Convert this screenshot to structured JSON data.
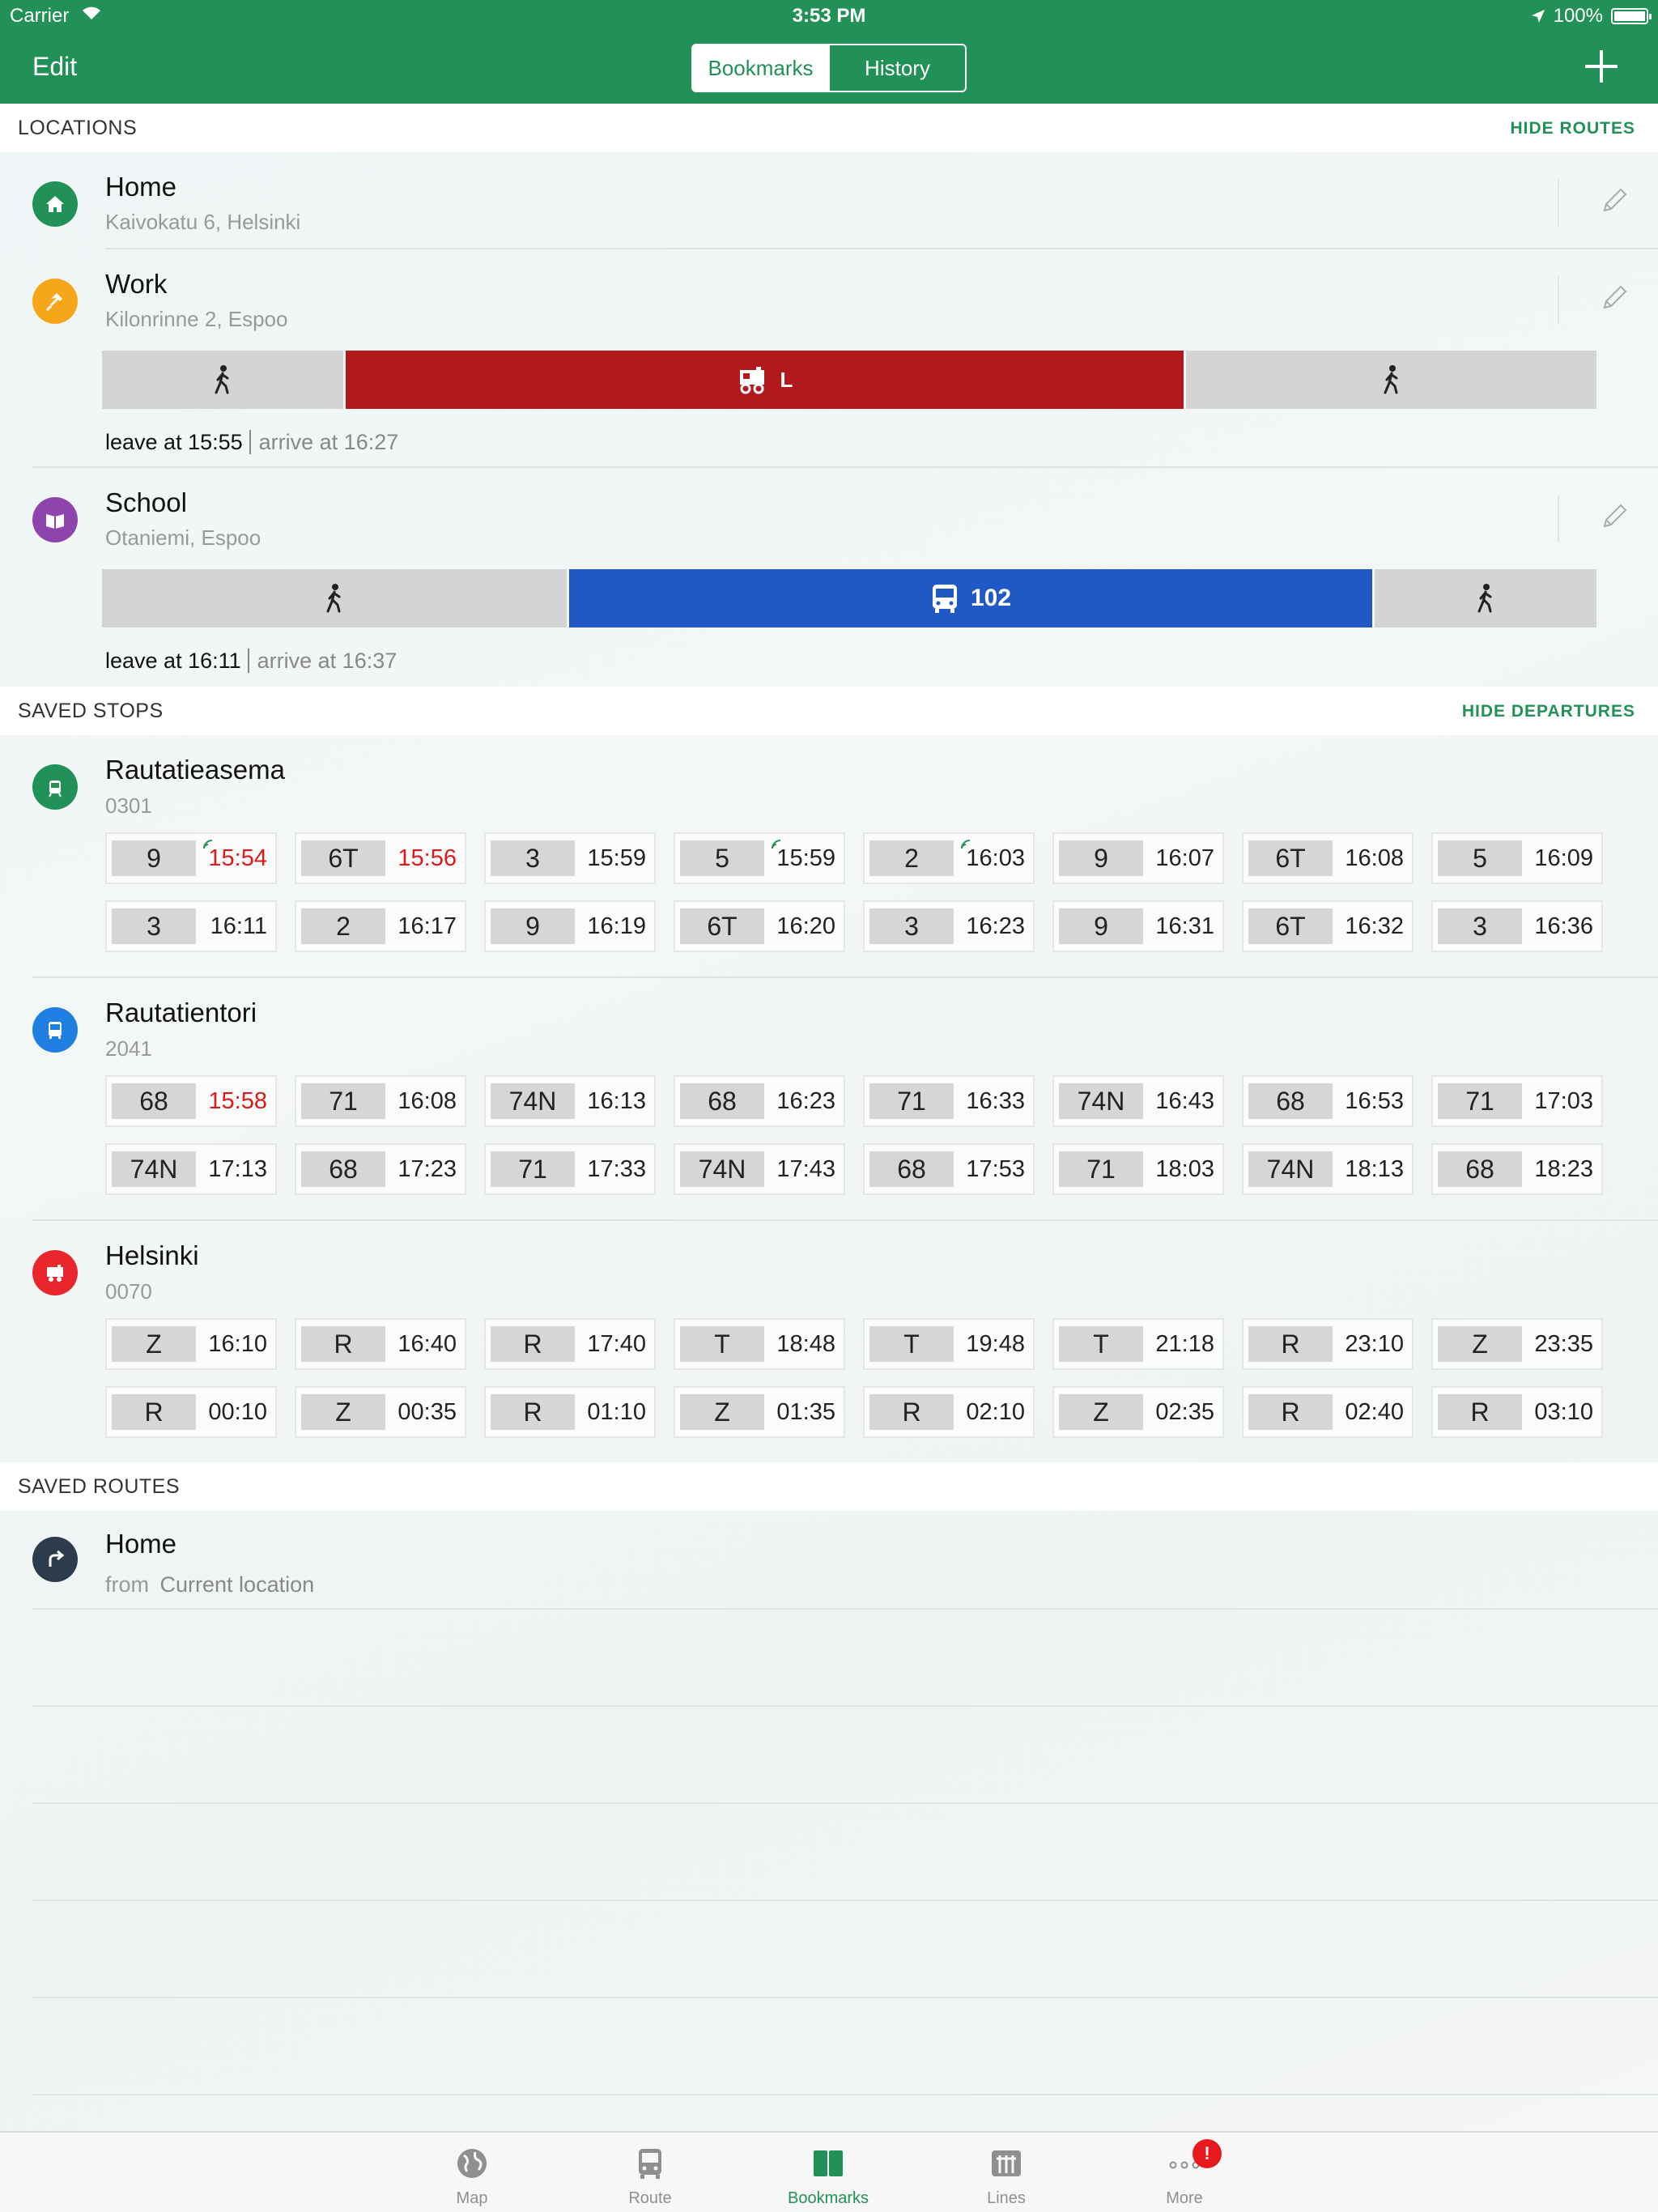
{
  "status_bar": {
    "carrier": "Carrier",
    "time": "3:53 PM",
    "battery": "100%"
  },
  "nav": {
    "edit": "Edit",
    "segments": [
      "Bookmarks",
      "History"
    ],
    "active_segment": "Bookmarks"
  },
  "locations": {
    "header": "LOCATIONS",
    "action": "HIDE ROUTES",
    "items": [
      {
        "name": "Home",
        "address": "Kaivokatu 6, Helsinki",
        "icon": "home-icon",
        "color": "#229157"
      },
      {
        "name": "Work",
        "address": "Kilonrinne 2, Espoo",
        "icon": "hammer-icon",
        "color": "#f6a719",
        "route": {
          "mode": "train",
          "line": "L",
          "leave": "leave at 15:55",
          "arrive": "arrive at 16:27"
        }
      },
      {
        "name": "School",
        "address": "Otaniemi, Espoo",
        "icon": "book-icon",
        "color": "#8e44ad",
        "route": {
          "mode": "bus",
          "line": "102",
          "leave": "leave at 16:11",
          "arrive": "arrive at 16:37"
        }
      }
    ]
  },
  "saved_stops": {
    "header": "SAVED STOPS",
    "action": "HIDE DEPARTURES",
    "stops": [
      {
        "name": "Rautatieasema",
        "code": "0301",
        "icon": "tram-icon",
        "color": "#229157",
        "departures": [
          {
            "line": "9",
            "time": "15:54",
            "late": true,
            "realtime": true
          },
          {
            "line": "6T",
            "time": "15:56",
            "late": true,
            "realtime": false
          },
          {
            "line": "3",
            "time": "15:59",
            "late": false,
            "realtime": false
          },
          {
            "line": "5",
            "time": "15:59",
            "late": false,
            "realtime": true
          },
          {
            "line": "2",
            "time": "16:03",
            "late": false,
            "realtime": true
          },
          {
            "line": "9",
            "time": "16:07",
            "late": false,
            "realtime": false
          },
          {
            "line": "6T",
            "time": "16:08",
            "late": false,
            "realtime": false
          },
          {
            "line": "5",
            "time": "16:09",
            "late": false,
            "realtime": false
          },
          {
            "line": "3",
            "time": "16:11",
            "late": false,
            "realtime": false
          },
          {
            "line": "2",
            "time": "16:17",
            "late": false,
            "realtime": false
          },
          {
            "line": "9",
            "time": "16:19",
            "late": false,
            "realtime": false
          },
          {
            "line": "6T",
            "time": "16:20",
            "late": false,
            "realtime": false
          },
          {
            "line": "3",
            "time": "16:23",
            "late": false,
            "realtime": false
          },
          {
            "line": "9",
            "time": "16:31",
            "late": false,
            "realtime": false
          },
          {
            "line": "6T",
            "time": "16:32",
            "late": false,
            "realtime": false
          },
          {
            "line": "3",
            "time": "16:36",
            "late": false,
            "realtime": false
          }
        ]
      },
      {
        "name": "Rautatientori",
        "code": "2041",
        "icon": "bus-icon",
        "color": "#1e7fe0",
        "departures": [
          {
            "line": "68",
            "time": "15:58",
            "late": true,
            "realtime": false
          },
          {
            "line": "71",
            "time": "16:08",
            "late": false,
            "realtime": false
          },
          {
            "line": "74N",
            "time": "16:13",
            "late": false,
            "realtime": false
          },
          {
            "line": "68",
            "time": "16:23",
            "late": false,
            "realtime": false
          },
          {
            "line": "71",
            "time": "16:33",
            "late": false,
            "realtime": false
          },
          {
            "line": "74N",
            "time": "16:43",
            "late": false,
            "realtime": false
          },
          {
            "line": "68",
            "time": "16:53",
            "late": false,
            "realtime": false
          },
          {
            "line": "71",
            "time": "17:03",
            "late": false,
            "realtime": false
          },
          {
            "line": "74N",
            "time": "17:13",
            "late": false,
            "realtime": false
          },
          {
            "line": "68",
            "time": "17:23",
            "late": false,
            "realtime": false
          },
          {
            "line": "71",
            "time": "17:33",
            "late": false,
            "realtime": false
          },
          {
            "line": "74N",
            "time": "17:43",
            "late": false,
            "realtime": false
          },
          {
            "line": "68",
            "time": "17:53",
            "late": false,
            "realtime": false
          },
          {
            "line": "71",
            "time": "18:03",
            "late": false,
            "realtime": false
          },
          {
            "line": "74N",
            "time": "18:13",
            "late": false,
            "realtime": false
          },
          {
            "line": "68",
            "time": "18:23",
            "late": false,
            "realtime": false
          }
        ]
      },
      {
        "name": "Helsinki",
        "code": "0070",
        "icon": "train-icon",
        "color": "#e8262b",
        "departures": [
          {
            "line": "Z",
            "time": "16:10",
            "late": false,
            "realtime": false
          },
          {
            "line": "R",
            "time": "16:40",
            "late": false,
            "realtime": false
          },
          {
            "line": "R",
            "time": "17:40",
            "late": false,
            "realtime": false
          },
          {
            "line": "T",
            "time": "18:48",
            "late": false,
            "realtime": false
          },
          {
            "line": "T",
            "time": "19:48",
            "late": false,
            "realtime": false
          },
          {
            "line": "T",
            "time": "21:18",
            "late": false,
            "realtime": false
          },
          {
            "line": "R",
            "time": "23:10",
            "late": false,
            "realtime": false
          },
          {
            "line": "Z",
            "time": "23:35",
            "late": false,
            "realtime": false
          },
          {
            "line": "R",
            "time": "00:10",
            "late": false,
            "realtime": false
          },
          {
            "line": "Z",
            "time": "00:35",
            "late": false,
            "realtime": false
          },
          {
            "line": "R",
            "time": "01:10",
            "late": false,
            "realtime": false
          },
          {
            "line": "Z",
            "time": "01:35",
            "late": false,
            "realtime": false
          },
          {
            "line": "R",
            "time": "02:10",
            "late": false,
            "realtime": false
          },
          {
            "line": "Z",
            "time": "02:35",
            "late": false,
            "realtime": false
          },
          {
            "line": "R",
            "time": "02:40",
            "late": false,
            "realtime": false
          },
          {
            "line": "R",
            "time": "03:10",
            "late": false,
            "realtime": false
          }
        ]
      }
    ]
  },
  "saved_routes": {
    "header": "SAVED ROUTES",
    "items": [
      {
        "name": "Home",
        "from_label": "from",
        "from": "Current location",
        "icon": "turn-right-icon",
        "color": "#2d3b4c"
      }
    ]
  },
  "tabs": [
    {
      "label": "Map",
      "icon": "globe-icon",
      "active": false
    },
    {
      "label": "Route",
      "icon": "bus-icon",
      "active": false
    },
    {
      "label": "Bookmarks",
      "icon": "bookmarks-icon",
      "active": true
    },
    {
      "label": "Lines",
      "icon": "lines-icon",
      "active": false
    },
    {
      "label": "More",
      "icon": "more-icon",
      "active": false,
      "badge": "!"
    }
  ],
  "colors": {
    "brand": "#229157",
    "late": "#dd1a1a",
    "train_bar": "#b01a1f",
    "bus_bar": "#2058c6"
  }
}
